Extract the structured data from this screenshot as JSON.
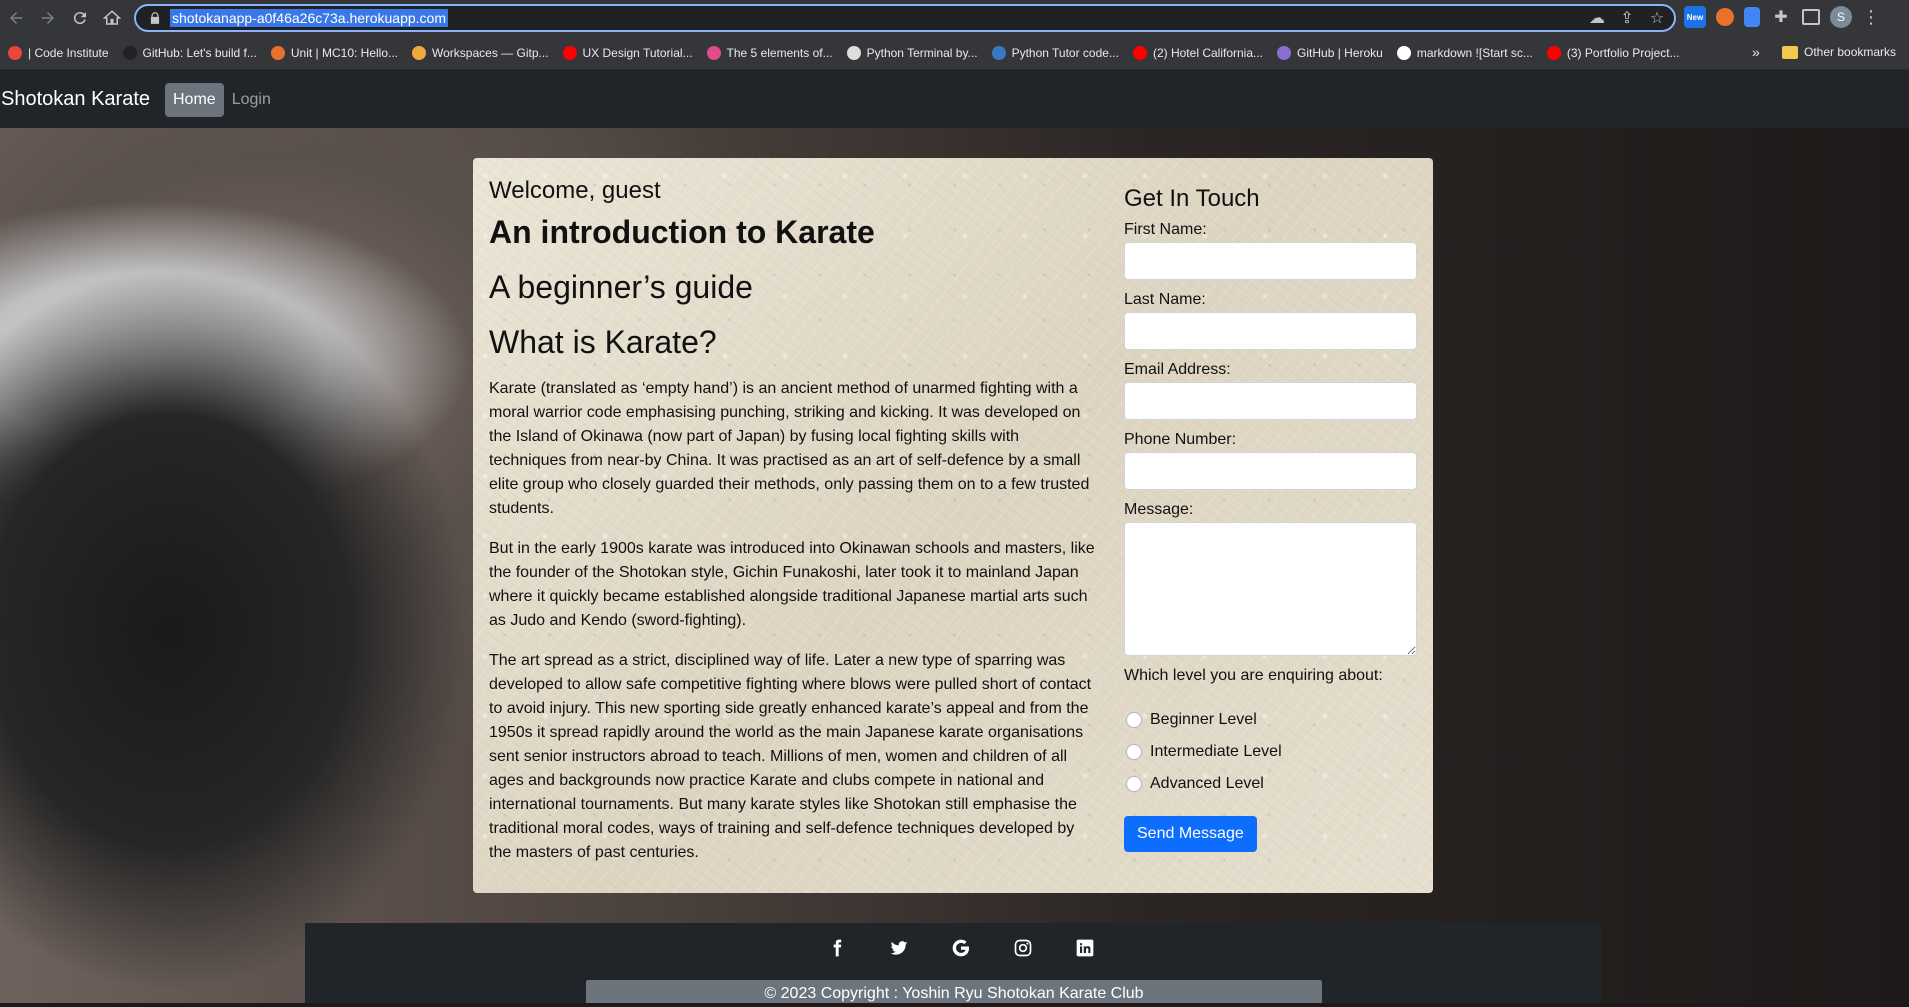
{
  "browser": {
    "url": "shotokanapp-a0f46a26c73a.herokuapp.com",
    "profile_initial": "S",
    "new_badge": "New",
    "bookmarks": [
      {
        "label": "| Code Institute",
        "color": "#e8453c"
      },
      {
        "label": "GitHub: Let's build f...",
        "color": "#222222"
      },
      {
        "label": "Unit | MC10: Hello...",
        "color": "#e8712c"
      },
      {
        "label": "Workspaces — Gitp...",
        "color": "#f2a93b"
      },
      {
        "label": "UX Design Tutorial...",
        "color": "#ff0000"
      },
      {
        "label": "The 5 elements of...",
        "color": "#e04b8a"
      },
      {
        "label": "Python Terminal by...",
        "color": "#dddddd"
      },
      {
        "label": "Python Tutor code...",
        "color": "#3b78c2"
      },
      {
        "label": "(2) Hotel California...",
        "color": "#ff0000"
      },
      {
        "label": "GitHub | Heroku",
        "color": "#8a6fd1"
      },
      {
        "label": "markdown ![Start sc...",
        "color": "#ffffff"
      },
      {
        "label": "(3) Portfolio Project...",
        "color": "#ff0000"
      }
    ],
    "more_bookmarks": "»",
    "other_bookmarks": "Other bookmarks"
  },
  "navbar": {
    "brand": "Shotokan Karate",
    "links": [
      "Home",
      "Login"
    ]
  },
  "main": {
    "welcome": "Welcome, guest",
    "title": "An introduction to Karate",
    "subtitle": "A beginner’s guide",
    "section_heading": "What is Karate?",
    "paragraphs": [
      "Karate (translated as ‘empty hand’) is an ancient method of unarmed fighting with a moral warrior code emphasising punching, striking and kicking. It was developed on the Island of Okinawa (now part of Japan) by fusing local fighting skills with techniques from near-by China. It was practised as an art of self-defence by a small elite group who closely guarded their methods, only passing them on to a few trusted students.",
      "But in the early 1900s karate was introduced into Okinawan schools and masters, like the founder of the Shotokan style, Gichin Funakoshi, later took it to mainland Japan where it quickly became established alongside traditional Japanese martial arts such as Judo and Kendo (sword-fighting).",
      "The art spread as a strict, disciplined way of life. Later a new type of sparring was developed to allow safe competitive fighting where blows were pulled short of contact to avoid injury. This new sporting side greatly enhanced karate’s appeal and from the 1950s it spread rapidly around the world as the main Japanese karate organisations sent senior instructors abroad to teach. Millions of men, women and children of all ages and backgrounds now practice Karate and clubs compete in national and international tournaments. But many karate styles like Shotokan still emphasise the traditional moral codes, ways of training and self-defence techniques developed by the masters of past centuries."
    ]
  },
  "contact": {
    "heading": "Get In Touch",
    "first_name": "First Name:",
    "last_name": "Last Name:",
    "email": "Email Address:",
    "phone": "Phone Number:",
    "message": "Message:",
    "level_question": "Which level you are enquiring about:",
    "levels": [
      "Beginner Level",
      "Intermediate Level",
      "Advanced Level"
    ],
    "submit": "Send Message"
  },
  "footer": {
    "socials": [
      "facebook-icon",
      "twitter-icon",
      "google-icon",
      "instagram-icon",
      "linkedin-icon"
    ],
    "copyright": "© 2023 Copyright : Yoshin Ryu Shotokan Karate Club"
  },
  "colors": {
    "navbar": "#212529",
    "active_link": "#6c757d",
    "button": "#0d6efd",
    "card": "#e4ddcc"
  }
}
